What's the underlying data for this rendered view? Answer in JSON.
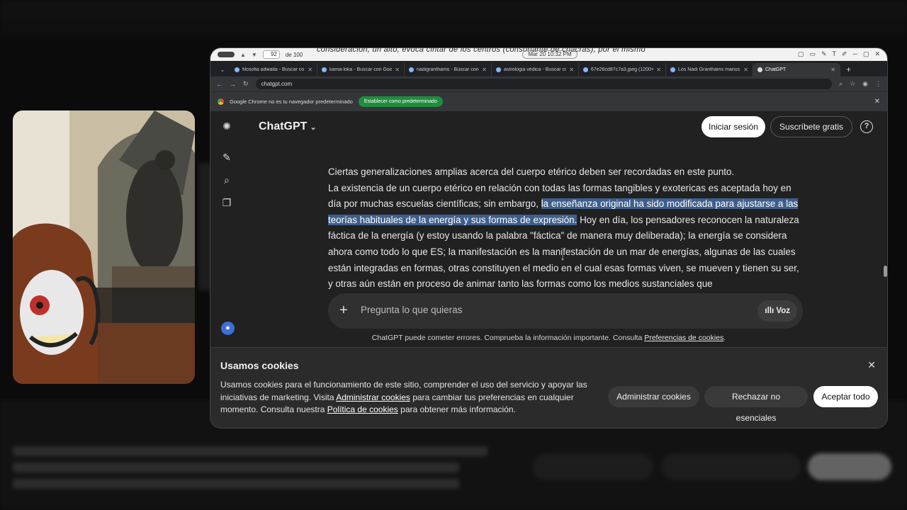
{
  "pdf_viewer": {
    "page_number": "92",
    "page_total": "de 100",
    "datetime": "Mar 20  10:32 PM",
    "overlay_text": "consideración, un alto, evoca cintar de los centros (consonante de chacras), por el mismo"
  },
  "browser": {
    "tabs": [
      {
        "label": "filosofia adwaita - Buscar co",
        "active": false
      },
      {
        "label": "kama-loka - Buscar con Goo",
        "active": false
      },
      {
        "label": "nadigranthams - Buscar con",
        "active": false
      },
      {
        "label": "astrologia védica - Buscar co",
        "active": false
      },
      {
        "label": "67e26cd87c7a3.jpeg (1200×",
        "active": false
      },
      {
        "label": "Los Nadi Granthams manus",
        "active": false
      },
      {
        "label": "ChatGPT",
        "active": true
      }
    ],
    "url": "chatgpt.com",
    "infobar_text": "Google Chrome no es tu navegador predeterminado",
    "infobar_button": "Establecer como predeterminado"
  },
  "chatgpt": {
    "model_label": "ChatGPT",
    "login_label": "Iniciar sesión",
    "signup_label": "Suscríbete gratis",
    "help_label": "?",
    "article": {
      "line1": "Ciertas generalizaciones amplias acerca del cuerpo etérico deben ser recordadas en este punto.",
      "pre": "La existencia de un cuerpo etérico en relación con todas las formas tangibles y exotericas es aceptada hoy en día por muchas escuelas científicas; sin embargo, ",
      "highlight": "la enseñanza original ha sido modificada para ajustarse a las teorías habituales de la energía y sus formas de expresión.",
      "post": " Hoy en día, los pensadores reconocen la naturaleza fáctica de la energía (y estoy usando la palabra \"fáctica\" de manera muy deliberada); la energía se considera ahora como todo lo que ES; la manifestación es la manifestación de un mar de energías, algunas de las cuales están integradas en formas, otras constituyen el medio en el cual esas formas viven, se mueven y tienen su ser, y otras aún están en proceso de animar tanto las formas como los medios sustanciales que"
    },
    "composer_placeholder": "Pregunta lo que quieras",
    "voice_label": "Voz",
    "disclaimer_text": "ChatGPT puede cometer errores. Comprueba la información importante. Consulta ",
    "disclaimer_link": "Preferencias de cookies",
    "disclaimer_end": "."
  },
  "cookies": {
    "title": "Usamos cookies",
    "body_1": "Usamos cookies para el funcionamiento de este sitio, comprender el uso del servicio y apoyar las iniciativas de marketing. Visita ",
    "link_1": "Administrar cookies",
    "body_2": " para cambiar tus preferencias en cualquier momento. Consulta nuestra ",
    "link_2": "Política de cookies",
    "body_3": " para obtener más información.",
    "manage_label": "Administrar cookies",
    "reject_label": "Rechazar no esenciales",
    "accept_label": "Aceptar todo"
  }
}
